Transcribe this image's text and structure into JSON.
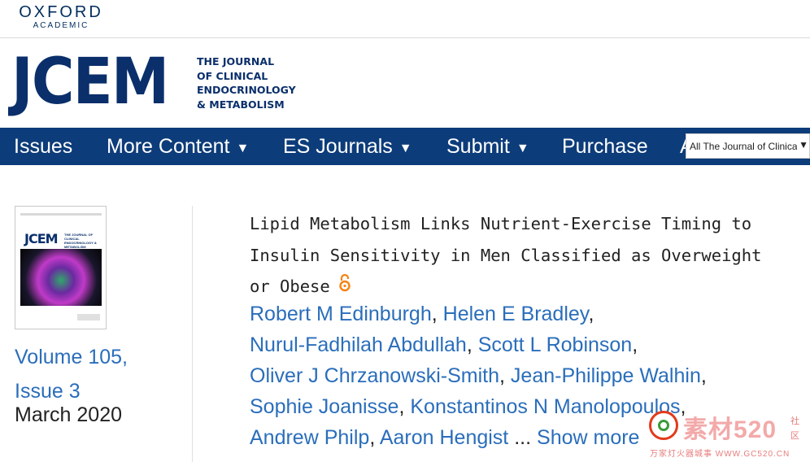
{
  "publisher": {
    "name": "OXFORD",
    "division": "ACADEMIC"
  },
  "journal": {
    "abbrev": "JCEM",
    "full_lines": [
      "THE JOURNAL",
      "OF CLINICAL",
      "ENDOCRINOLOGY",
      "& METABOLISM"
    ]
  },
  "nav": {
    "items": [
      {
        "label": "Issues",
        "caret": ""
      },
      {
        "label": "More Content",
        "caret": "▼"
      },
      {
        "label": "ES Journals",
        "caret": "▼"
      },
      {
        "label": "Submit",
        "caret": "▼"
      },
      {
        "label": "Purchase",
        "caret": ""
      },
      {
        "label": "A",
        "caret": ""
      }
    ],
    "search_scope": {
      "value": "All The Journal of Clinica",
      "caret": "▼"
    }
  },
  "issue": {
    "cover_title": "JCEM",
    "volume": "Volume 105,",
    "issue": "Issue 3",
    "date": "March 2020"
  },
  "article": {
    "title": "Lipid Metabolism Links Nutrient-Exercise Timing to Insulin Sensitivity in Men Classified as Overweight or Obese",
    "open_access_icon": "open-access-icon",
    "authors": [
      "Robert M Edinburgh",
      "Helen E Bradley",
      "Nurul-Fadhilah Abdullah",
      "Scott L Robinson",
      "Oliver J Chrzanowski-Smith",
      "Jean-Philippe Walhin",
      "Sophie Joanisse",
      "Konstantinos N Manolopoulos",
      "Andrew Philp",
      "Aaron Hengist"
    ],
    "ellipsis": "...",
    "show_more": "Show more"
  },
  "watermark": {
    "brand": "素材520",
    "side": "社区",
    "url": "万家灯火器城事 WWW.GC520.CN"
  },
  "colors": {
    "navy": "#0d3c7a",
    "link": "#2a6ebb",
    "oa_orange": "#f68212"
  }
}
